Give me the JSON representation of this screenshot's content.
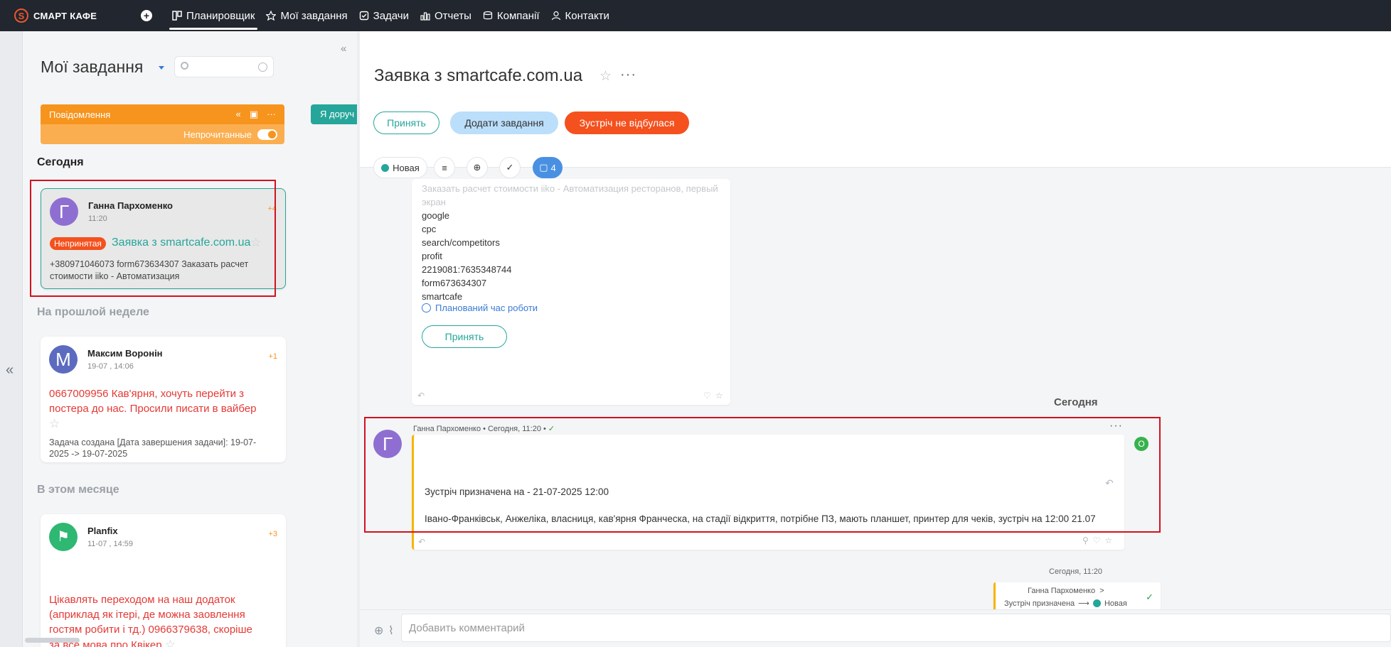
{
  "brand": {
    "name": "СМАРТ КАФЕ",
    "logo_letter": "S"
  },
  "nav": [
    {
      "label": "Планировщик",
      "icon": "planner-icon",
      "active": true
    },
    {
      "label": "Мої завдання",
      "icon": "star-icon"
    },
    {
      "label": "Задачи",
      "icon": "tasks-icon"
    },
    {
      "label": "Отчеты",
      "icon": "reports-icon"
    },
    {
      "label": "Компанії",
      "icon": "companies-icon"
    },
    {
      "label": "Контакти",
      "icon": "contacts-icon"
    }
  ],
  "sidebar": {
    "title": "Мої завдання",
    "search_placeholder": "",
    "notifications": {
      "label": "Повідомлення",
      "unread_label": "Непрочитанные",
      "unread_toggle": true
    },
    "assigned_tab": "Я доруч",
    "groups": [
      {
        "title": "Сегодня"
      },
      {
        "title": "На прошлой неделе"
      },
      {
        "title": "В этом месяце"
      }
    ],
    "cards": [
      {
        "avatar_letter": "Г",
        "avatar_color": "#8e6fd1",
        "author": "Ганна Пархоменко",
        "time": "11:20",
        "count": "+4",
        "badge": "Непринятая",
        "link": "Заявка з smartcafe.com.ua",
        "snippet": "+380971046073 form673634307 Заказать расчет стоимости iiko - Автоматизация"
      },
      {
        "avatar_letter": "М",
        "avatar_color": "#5c6bc0",
        "author": "Максим Воронін",
        "time": "19-07 , 14:06",
        "count": "+1",
        "text": "0667009956 Кав'ярня, хочуть перейти з постера до нас. Просили писати в вайбер",
        "meta": "Задача создана [Дата завершения задачи]: 19-07-2025 -> 19-07-2025"
      },
      {
        "avatar_letter": "⚑",
        "avatar_color": "#2eb872",
        "author": "Planfix",
        "time": "11-07 , 14:59",
        "count": "+3",
        "text": "Цікавлять переходом на наш додаток (априклад як ітері, де можна заовлення гостям робити і тд.) 0966379638, скоріше за все мова про Квікер"
      }
    ]
  },
  "task": {
    "title": "Заявка з smartcafe.com.ua",
    "buttons": {
      "accept": "Принять",
      "add_task": "Додати завдання",
      "meeting_failed": "Зустріч не відбулася"
    },
    "status": "Новая",
    "comments_count": "4",
    "message1": {
      "faded_line": "Заказать расчет стоимости iiko - Автоматизация ресторанов, первый экран",
      "lines": [
        "google",
        "cpc",
        "search/competitors",
        "profit",
        "2219081:7635348744",
        "form673634307",
        "smartcafe"
      ],
      "schedule_label": "Планований час роботи",
      "accept_label": "Принять"
    },
    "today_label": "Сегодня",
    "message2": {
      "avatar_letter": "Г",
      "author": "Ганна Пархоменко",
      "time": "Сегодня, 11:20",
      "line1": "Зустріч призначена на - 21-07-2025 12:00",
      "line2": "Івано-Франківськ, Анжеліка, власниця, кав'ярня Франческа, на стадії відкриття, потрібне ПЗ, мають планшет, принтер для чеків, зустріч на 12:00 21.07",
      "online_letter": "О"
    },
    "event": {
      "time": "Сегодня, 11:20",
      "author": "Ганна Пархоменко",
      "from": "Зустріч призначена",
      "to": "Новая"
    },
    "composer_placeholder": "Добавить комментарий"
  },
  "colors": {
    "accent_orange": "#f7941d",
    "teal": "#26a69a",
    "danger": "#f4511e",
    "highlight_box": "#d1121f"
  }
}
